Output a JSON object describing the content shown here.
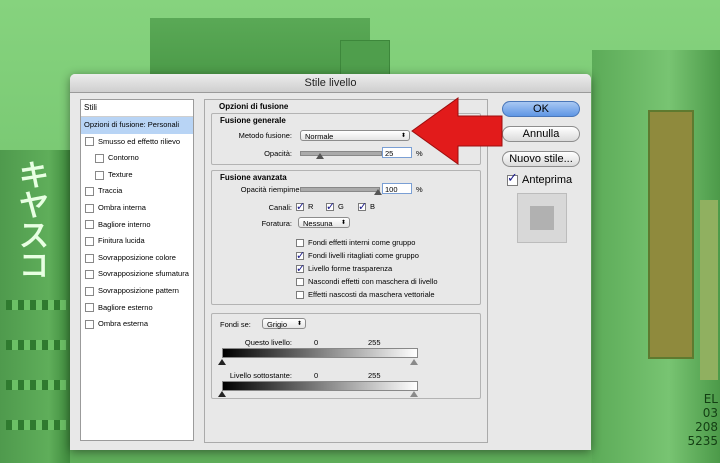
{
  "background": {
    "left_sign_text": "キヤスコ",
    "bottom_right_text": "EL\n03\n208\n5235"
  },
  "dialog": {
    "title": "Stile livello"
  },
  "styles_list": {
    "header": "Stili",
    "items": [
      {
        "label": "Opzioni di fusione: Personali",
        "selected": true,
        "checkbox": false,
        "indent": false
      },
      {
        "label": "Smusso ed effetto rilievo",
        "checkbox": true,
        "indent": false
      },
      {
        "label": "Contorno",
        "checkbox": true,
        "indent": true
      },
      {
        "label": "Texture",
        "checkbox": true,
        "indent": true
      },
      {
        "label": "Traccia",
        "checkbox": true,
        "indent": false
      },
      {
        "label": "Ombra interna",
        "checkbox": true,
        "indent": false
      },
      {
        "label": "Bagliore interno",
        "checkbox": true,
        "indent": false
      },
      {
        "label": "Finitura lucida",
        "checkbox": true,
        "indent": false
      },
      {
        "label": "Sovrapposizione colore",
        "checkbox": true,
        "indent": false
      },
      {
        "label": "Sovrapposizione sfumatura",
        "checkbox": true,
        "indent": false
      },
      {
        "label": "Sovrapposizione pattern",
        "checkbox": true,
        "indent": false
      },
      {
        "label": "Bagliore esterno",
        "checkbox": true,
        "indent": false
      },
      {
        "label": "Ombra esterna",
        "checkbox": true,
        "indent": false
      }
    ]
  },
  "blending": {
    "panel_title": "Opzioni di fusione",
    "general": {
      "title": "Fusione generale",
      "mode_label": "Metodo fusione:",
      "mode_value": "Normale",
      "opacity_label": "Opacità:",
      "opacity_value": "25",
      "opacity_unit": "%",
      "opacity_level": 0.25
    },
    "advanced": {
      "title": "Fusione avanzata",
      "fill_label": "Opacità riempimento:",
      "fill_value": "100",
      "fill_unit": "%",
      "fill_level": 1.0,
      "channels_label": "Canali:",
      "channels": [
        {
          "label": "R",
          "checked": true
        },
        {
          "label": "G",
          "checked": true
        },
        {
          "label": "B",
          "checked": true
        }
      ],
      "knockout_label": "Foratura:",
      "knockout_value": "Nessuna",
      "options": [
        {
          "label": "Fondi effetti interni come gruppo",
          "checked": false
        },
        {
          "label": "Fondi livelli ritagliati come gruppo",
          "checked": true
        },
        {
          "label": "Livello forme trasparenza",
          "checked": true
        },
        {
          "label": "Nascondi effetti con maschera di livello",
          "checked": false
        },
        {
          "label": "Effetti nascosti da maschera vettoriale",
          "checked": false
        }
      ]
    },
    "blend_if": {
      "label": "Fondi se:",
      "value": "Grigio",
      "this_layer_label": "Questo livello:",
      "this_layer_min": "0",
      "this_layer_max": "255",
      "underlying_label": "Livello sottostante:",
      "underlying_min": "0",
      "underlying_max": "255"
    }
  },
  "buttons": {
    "ok": "OK",
    "cancel": "Annulla",
    "new_style": "Nuovo stile...",
    "preview_label": "Anteprima",
    "preview_checked": true
  },
  "colors": {
    "overlay_green": "#6fc06a",
    "arrow_red": "#e21b1b",
    "selection_blue": "#b8d4f5",
    "ok_blue": "#5f96e4"
  },
  "icons": {
    "annotation": "red-arrow-icon",
    "dropdown": "chevron-updown-icon",
    "slider_thumb": "triangle-icon",
    "checkbox": "checkmark-icon"
  }
}
